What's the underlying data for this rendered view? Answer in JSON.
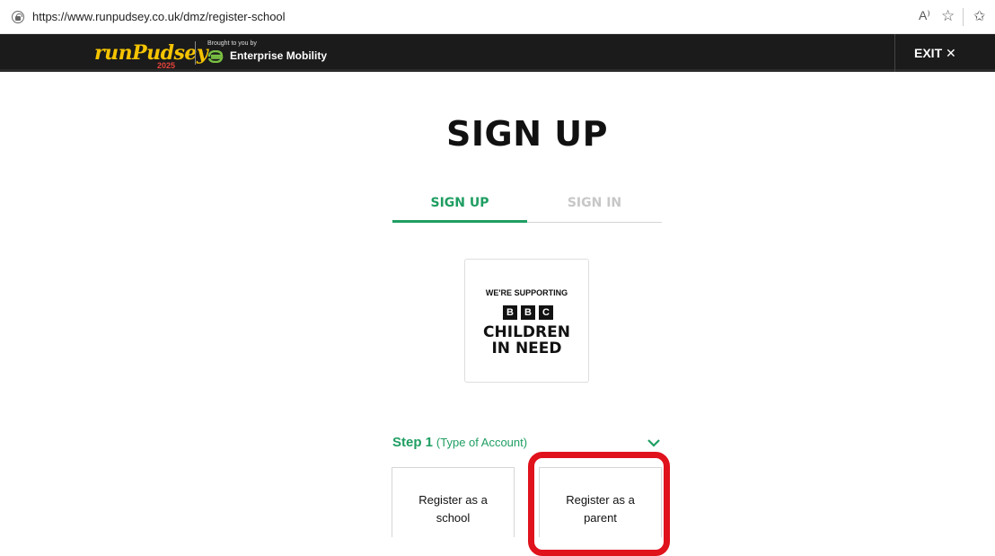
{
  "browser": {
    "url": "https://www.runpudsey.co.uk/dmz/register-school",
    "read_aloud_glyph": "A⁾",
    "favorite_glyph": "☆",
    "favorites_bar_glyph": "✩"
  },
  "header": {
    "logo_run": "run",
    "logo_pudsey": "Pudsey",
    "logo_year": "2025",
    "brought_by": "Brought to you by",
    "sponsor": "Enterprise Mobility",
    "exit_label": "EXIT ✕",
    "colors": {
      "bg": "#1b1b1b",
      "logo": "#f5c400",
      "sponsor_green": "#7ac143"
    }
  },
  "page": {
    "title": "SIGN UP",
    "tabs": [
      {
        "label": "SIGN UP",
        "active": true
      },
      {
        "label": "SIGN IN",
        "active": false
      }
    ],
    "charity": {
      "line1": "WE'RE SUPPORTING",
      "bbc": [
        "B",
        "B",
        "C"
      ],
      "line2": "CHILDREN",
      "line3": "IN NEED"
    },
    "step": {
      "number": "Step 1",
      "subtitle": "(Type of Account)"
    },
    "options": [
      {
        "line1": "Register as a",
        "line2": "school"
      },
      {
        "line1": "Register as a",
        "line2": "parent"
      }
    ],
    "colors": {
      "accent": "#1f9e62",
      "highlight": "#e0121c"
    }
  }
}
